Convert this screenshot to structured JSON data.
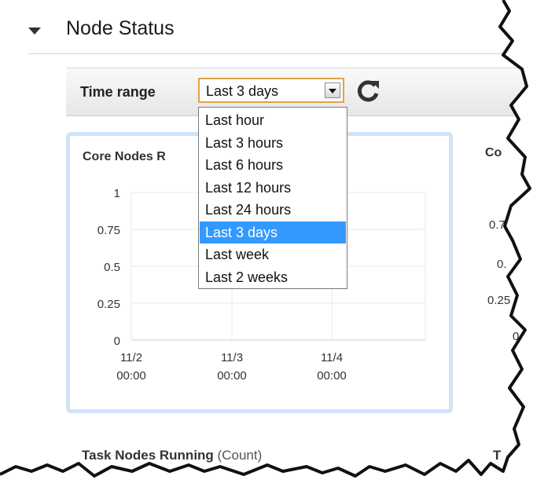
{
  "section": {
    "title": "Node Status",
    "collapse_icon": "caret-down-icon"
  },
  "toolbar": {
    "time_range_label": "Time range",
    "selected": "Last 3 days",
    "refresh_icon": "refresh-icon"
  },
  "dropdown": {
    "options": [
      "Last hour",
      "Last 3 hours",
      "Last 6 hours",
      "Last 12 hours",
      "Last 24 hours",
      "Last 3 days",
      "Last week",
      "Last 2 weeks"
    ],
    "selected_index": 5
  },
  "chart_left": {
    "title": "Core Nodes R"
  },
  "chart_right": {
    "title": "Co",
    "ticks": [
      "0.7",
      "0.",
      "0.25",
      "0"
    ]
  },
  "chart_data": {
    "type": "line",
    "title": "Core Nodes R",
    "xlabel": "",
    "ylabel": "",
    "x_ticks": [
      [
        "11/2",
        "00:00"
      ],
      [
        "11/3",
        "00:00"
      ],
      [
        "11/4",
        "00:00"
      ]
    ],
    "y_ticks": [
      "1",
      "0.75",
      "0.5",
      "0.25",
      "0"
    ],
    "ylim": [
      0,
      1
    ],
    "grid": true,
    "series": []
  },
  "bottom": {
    "left_title": "Task Nodes Running",
    "left_unit": "(Count)",
    "right_title": "T"
  },
  "colors": {
    "accent": "#e0a24a",
    "selection": "#3399ff",
    "card_border": "#cfe3f8"
  }
}
